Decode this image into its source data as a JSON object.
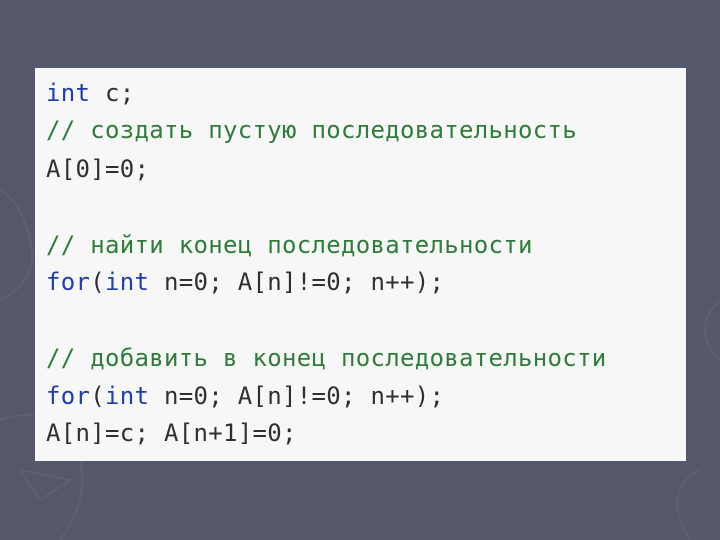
{
  "colors": {
    "slide_background": "#54586a",
    "code_background": "#f7f7f7",
    "keyword": "#1f3fae",
    "comment": "#2f7d3a",
    "text": "#303030"
  },
  "code": {
    "line1": {
      "kw": "int",
      "rest": " c;"
    },
    "line2": {
      "comment": "// создать пустую последовательность"
    },
    "line3": {
      "text": "A[0]=0;"
    },
    "line4": {
      "comment": "// найти конец последовательности"
    },
    "line5": {
      "kw1": "for",
      "p1": "(",
      "kw2": "int",
      "rest": " n=0; A[n]!=0; n++);"
    },
    "line6": {
      "comment": "// добавить в конец последовательности"
    },
    "line7": {
      "kw1": "for",
      "p1": "(",
      "kw2": "int",
      "rest": " n=0; A[n]!=0; n++);"
    },
    "line8": {
      "text": "A[n]=c; A[n+1]=0;"
    }
  }
}
